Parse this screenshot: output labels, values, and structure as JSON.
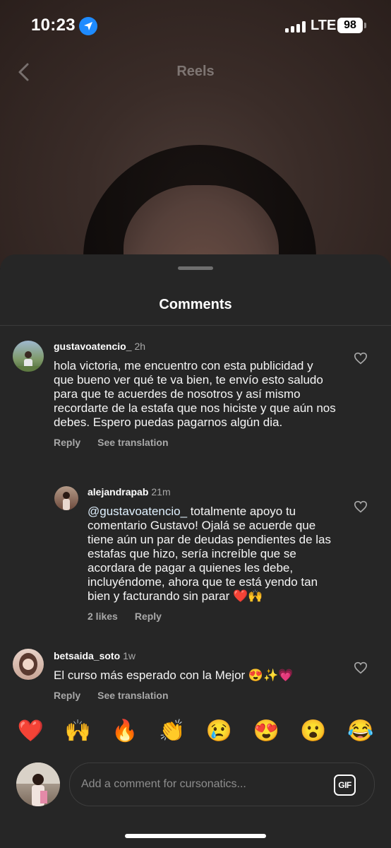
{
  "status_bar": {
    "time": "10:23",
    "network": "LTE",
    "battery": "98"
  },
  "nav": {
    "title": "Reels"
  },
  "sheet": {
    "title": "Comments"
  },
  "comments": [
    {
      "username": "gustavoatencio_",
      "time": "2h",
      "text": "hola victoria, me encuentro con esta publicidad y que bueno ver qué te va bien, te envío esto saludo para que te acuerdes de nosotros y así mismo recordarte de la estafa que nos hiciste y que aún nos debes. Espero puedas pagarnos algún dia.",
      "reply_label": "Reply",
      "translate_label": "See translation"
    },
    {
      "username": "alejandrapab",
      "time": "21m",
      "mention": "@gustavoatencio_",
      "text": " totalmente apoyo tu comentario Gustavo! Ojalá se acuerde que tiene aún un par de deudas pendientes de las estafas que hizo, sería increíble que se acordara de pagar a quienes les debe, incluyéndome, ahora que te está yendo tan bien y facturando sin parar ❤️🙌",
      "likes_label": "2 likes",
      "reply_label": "Reply"
    },
    {
      "username": "betsaida_soto",
      "time": "1w",
      "text": "El curso más esperado con la Mejor 😍✨💗",
      "reply_label": "Reply",
      "translate_label": "See translation"
    }
  ],
  "emoji_bar": [
    "❤️",
    "🙌",
    "🔥",
    "👏",
    "😢",
    "😍",
    "😮",
    "😂"
  ],
  "composer": {
    "placeholder": "Add a comment for cursonatics...",
    "gif_label": "GIF"
  },
  "colors": {
    "sheet_bg": "#262626",
    "secondary_text": "#a8a8a8",
    "location_blue": "#1e8bff"
  }
}
